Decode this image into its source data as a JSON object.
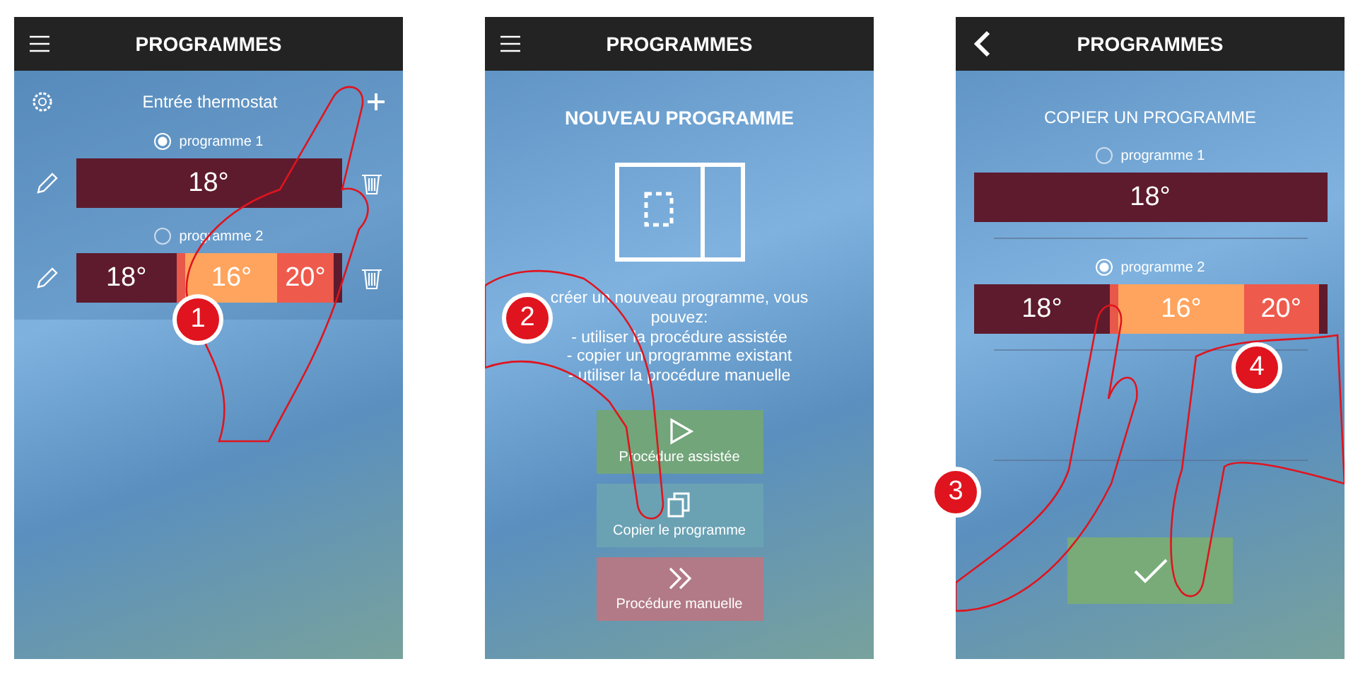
{
  "screens": [
    {
      "kind": "list",
      "header": {
        "kind": "menu",
        "title": "PROGRAMMES"
      },
      "toolbar": {
        "title": "Entrée thermostat"
      },
      "programs": [
        {
          "name": "programme 1",
          "selected": true,
          "segments": [
            {
              "label": "18°",
              "color": "#5e1b2d"
            }
          ]
        },
        {
          "name": "programme 2",
          "selected": false,
          "segments": [
            {
              "label": "18°",
              "color": "#5e1b2d"
            },
            {
              "color": "#e8584a"
            },
            {
              "label": "16°",
              "color": "#ffa45e"
            },
            {
              "label": "20°",
              "color": "#ee5a4c"
            },
            {
              "color": "#5e1b2d"
            }
          ]
        }
      ],
      "steps": [
        "1"
      ]
    },
    {
      "kind": "new",
      "header": {
        "kind": "menu",
        "title": "PROGRAMMES"
      },
      "heading": "NOUVEAU PROGRAMME",
      "text": "créer un nouveau programme, vous\npouvez:\n- utiliser la procédure assistée\n- copier un programme existant\n- utiliser la procédure manuelle",
      "options": [
        {
          "kind": "play",
          "label": "Procédure assistée",
          "color": "#72a57a"
        },
        {
          "kind": "copy",
          "label": "Copier le programme",
          "color": "#6aa2b4"
        },
        {
          "kind": "forward",
          "label": "Procédure manuelle",
          "color": "#b27a86"
        }
      ],
      "steps": [
        "2"
      ]
    },
    {
      "kind": "copy",
      "header": {
        "kind": "back",
        "title": "PROGRAMMES"
      },
      "heading": "COPIER UN PROGRAMME",
      "programs": [
        {
          "name": "programme 1",
          "selected": false,
          "segments": [
            {
              "label": "18°",
              "color": "#5e1b2d"
            }
          ]
        },
        {
          "name": "programme 2",
          "selected": true,
          "segments": [
            {
              "label": "18°",
              "color": "#5e1b2d"
            },
            {
              "color": "#e8584a"
            },
            {
              "label": "16°",
              "color": "#ffa45e"
            },
            {
              "label": "20°",
              "color": "#ee5a4c"
            },
            {
              "color": "#5e1b2d"
            }
          ]
        }
      ],
      "steps": [
        "3",
        "4"
      ]
    }
  ]
}
